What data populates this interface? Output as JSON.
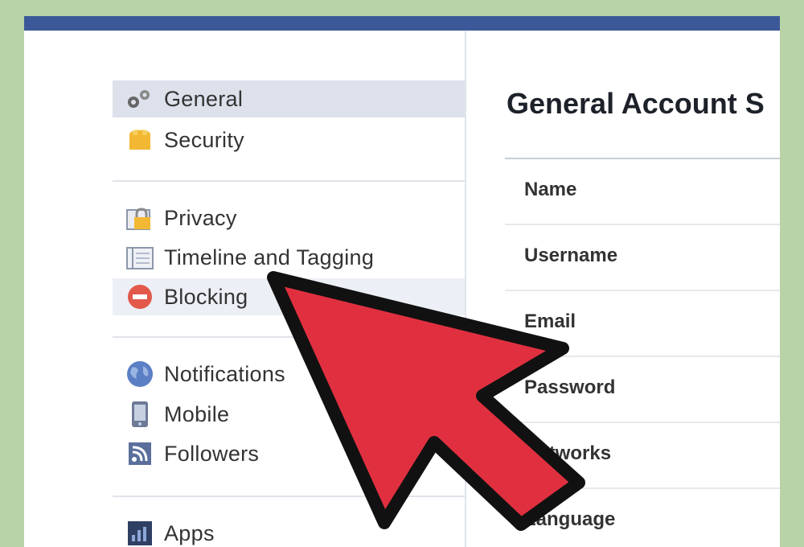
{
  "sidebar": {
    "items": [
      {
        "label": "General",
        "icon": "gear-icon",
        "state": "selected"
      },
      {
        "label": "Security",
        "icon": "badge-icon"
      },
      {
        "label": "Privacy",
        "icon": "lock-icon"
      },
      {
        "label": "Timeline and Tagging",
        "icon": "timeline-icon"
      },
      {
        "label": "Blocking",
        "icon": "block-icon",
        "state": "hover"
      },
      {
        "label": "Notifications",
        "icon": "globe-icon"
      },
      {
        "label": "Mobile",
        "icon": "mobile-icon"
      },
      {
        "label": "Followers",
        "icon": "rss-icon"
      },
      {
        "label": "Apps",
        "icon": "apps-icon"
      }
    ]
  },
  "main": {
    "title": "General Account S",
    "settings": [
      {
        "label": "Name"
      },
      {
        "label": "Username"
      },
      {
        "label": "Email"
      },
      {
        "label": "Password"
      },
      {
        "label": "Networks"
      },
      {
        "label": "Language"
      }
    ]
  },
  "colors": {
    "background": "#b9d3a8",
    "topbar": "#3b5998",
    "selected": "#dce1eb",
    "arrow": "#e03040"
  }
}
